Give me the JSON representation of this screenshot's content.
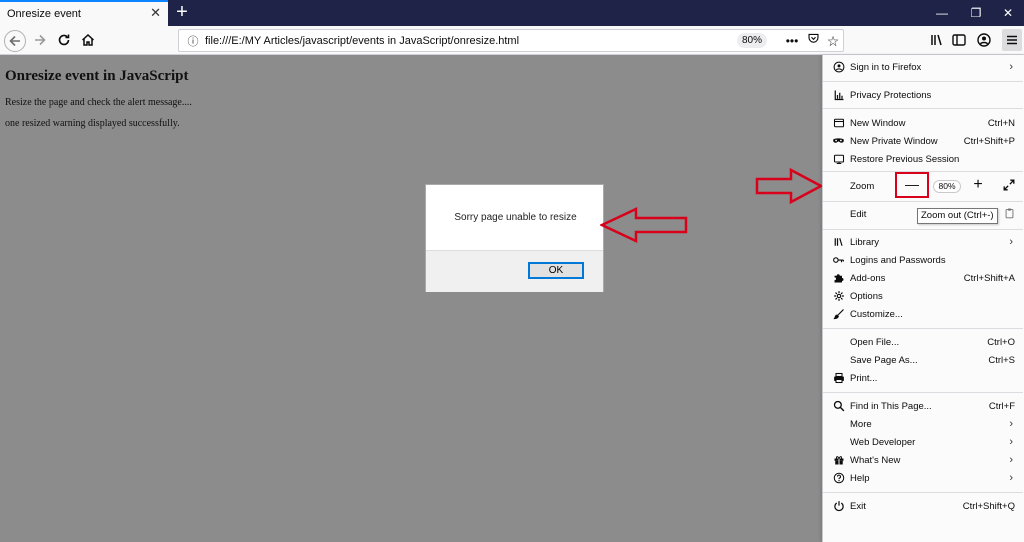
{
  "window": {
    "tab_title": "Onresize event",
    "tab_close": "✕",
    "new_tab": "+",
    "minimize": "—",
    "restore": "❐",
    "close": "✕"
  },
  "navbar": {
    "url": "file:///E:/MY Articles/javascript/events in JavaScript/onresize.html",
    "zoom": "80%"
  },
  "page": {
    "heading": "Onresize event in JavaScript",
    "line1": "Resize the page and check the alert message....",
    "line2": "one resized warning displayed successfully."
  },
  "alert": {
    "message": "Sorry page unable to resize",
    "ok_label": "OK"
  },
  "menu": {
    "sign_in": "Sign in to Firefox",
    "privacy": "Privacy Protections",
    "new_window": "New Window",
    "new_window_short": "Ctrl+N",
    "new_private": "New Private Window",
    "new_private_short": "Ctrl+Shift+P",
    "restore_session": "Restore Previous Session",
    "zoom_label": "Zoom",
    "zoom_minus": "—",
    "zoom_value": "80%",
    "zoom_plus": "+",
    "edit_label": "Edit",
    "zoom_tooltip": "Zoom out (Ctrl+-)",
    "library": "Library",
    "logins": "Logins and Passwords",
    "addons": "Add-ons",
    "addons_short": "Ctrl+Shift+A",
    "options": "Options",
    "customize": "Customize...",
    "open_file": "Open File...",
    "open_file_short": "Ctrl+O",
    "save_page": "Save Page As...",
    "save_page_short": "Ctrl+S",
    "print": "Print...",
    "find": "Find in This Page...",
    "find_short": "Ctrl+F",
    "more": "More",
    "web_dev": "Web Developer",
    "whats_new": "What's New",
    "help": "Help",
    "exit": "Exit",
    "exit_short": "Ctrl+Shift+Q"
  },
  "colors": {
    "accent": "#0a84ff",
    "annotation_red": "#d9001b",
    "tabstrip": "#1f2347",
    "page_bg": "#8c8c8c"
  }
}
